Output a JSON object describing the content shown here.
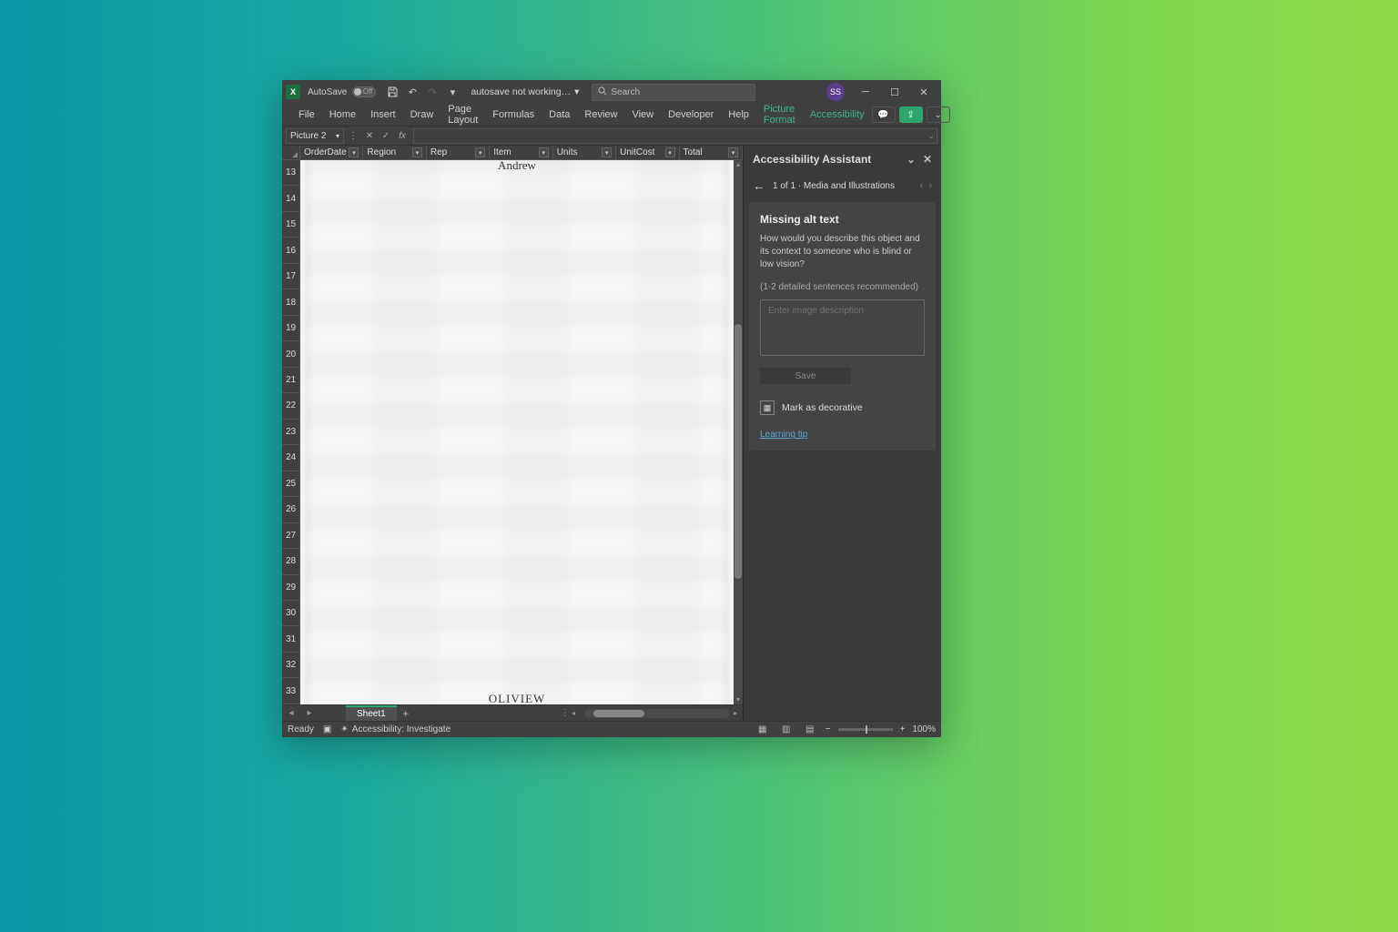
{
  "titleBar": {
    "autoSaveLabel": "AutoSave",
    "autoSaveState": "Off",
    "docName": "autosave not working…",
    "searchPlaceholder": "Search",
    "userInitials": "SS"
  },
  "ribbon": {
    "tabs": [
      "File",
      "Home",
      "Insert",
      "Draw",
      "Page Layout",
      "Formulas",
      "Data",
      "Review",
      "View",
      "Developer",
      "Help"
    ],
    "contextualTabs": [
      "Picture Format",
      "Accessibility"
    ]
  },
  "formulaBar": {
    "nameBox": "Picture 2",
    "fx": "fx",
    "formula": ""
  },
  "columns": [
    "OrderDate",
    "Region",
    "Rep",
    "Item",
    "Units",
    "UnitCost",
    "Total"
  ],
  "rows": [
    "13",
    "14",
    "15",
    "16",
    "17",
    "18",
    "19",
    "20",
    "21",
    "22",
    "23",
    "24",
    "25",
    "26",
    "27",
    "28",
    "29",
    "30",
    "31",
    "32",
    "33"
  ],
  "picture": {
    "topText": "Andrew",
    "bottomText": "OLIVIEW"
  },
  "sheetTabs": {
    "active": "Sheet1"
  },
  "statusBar": {
    "ready": "Ready",
    "accessibility": "Accessibility: Investigate",
    "zoom": "100%"
  },
  "panel": {
    "title": "Accessibility Assistant",
    "navText": "1 of 1 · Media and Illustrations",
    "issueTitle": "Missing alt text",
    "issueDesc": "How would you describe this object and its context to someone who is blind or low vision?",
    "issueHint": "(1-2 detailed sentences recommended)",
    "altPlaceholder": "Enter image description",
    "saveLabel": "Save",
    "decorativeLabel": "Mark as decorative",
    "learningTip": "Learning tip"
  }
}
